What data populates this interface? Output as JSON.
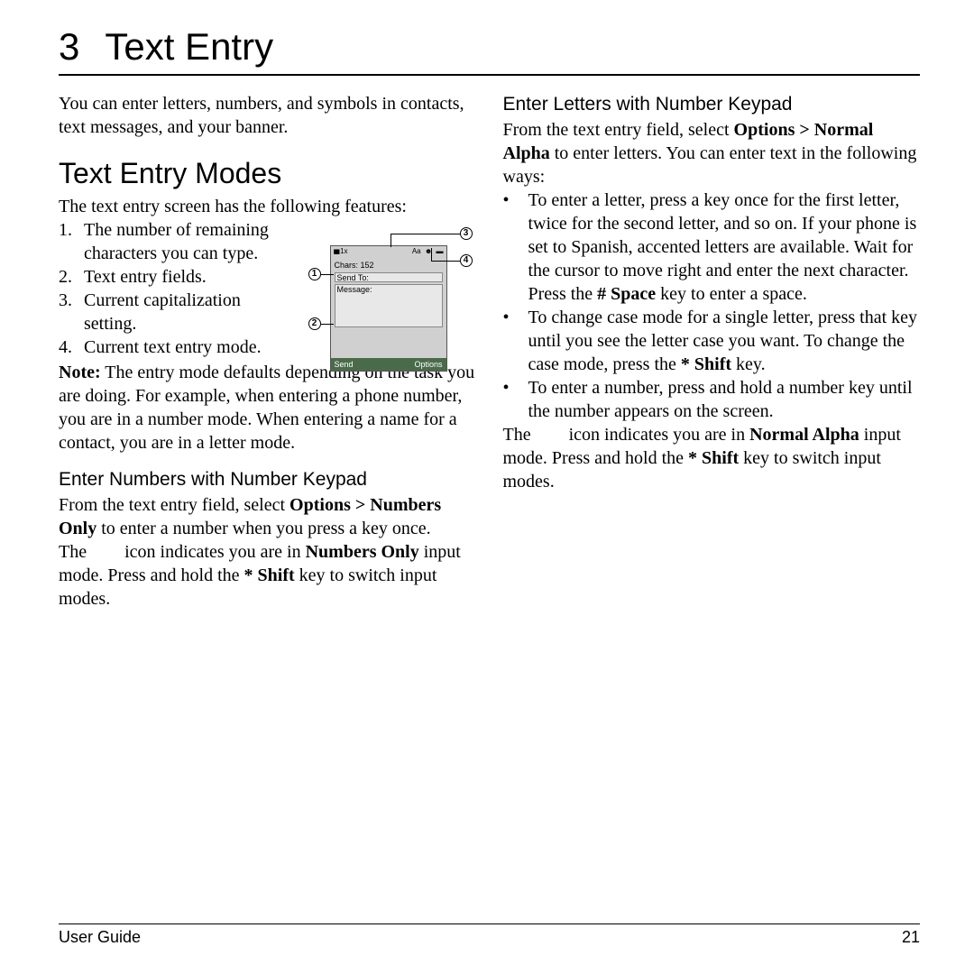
{
  "chapter": {
    "number": "3",
    "title": "Text Entry"
  },
  "intro": "You can enter letters, numbers, and symbols in contacts, text messages, and your banner.",
  "modes": {
    "heading": "Text Entry Modes",
    "lead": "The text entry screen has the following features:",
    "features": [
      "The number of remaining characters you can type.",
      "Text entry fields.",
      "Current capitalization setting.",
      "Current text entry mode."
    ],
    "note_label": "Note:",
    "note": " The entry mode defaults depending on the task you are doing. For example, when entering a phone number, you are in a number mode. When entering a name for a contact, you are in a letter mode."
  },
  "numbers_section": {
    "heading": "Enter Numbers with Number Keypad",
    "p1a": "From the text entry field, select ",
    "p1b": "Options > Numbers Only",
    "p1c": " to enter a number when you press a key once.",
    "p2a": "The ",
    "p2b": " icon indicates you are in ",
    "p2c": "Numbers Only",
    "p2d": " input mode. Press and hold the ",
    "p2e": "* Shift",
    "p2f": " key to switch input modes."
  },
  "letters_section": {
    "heading": "Enter Letters with Number Keypad",
    "p1a": "From the text entry field, select ",
    "p1b": "Options > Normal Alpha",
    "p1c": " to enter letters. You can enter text in the following ways:",
    "bullets": [
      {
        "a": "To enter a letter, press a key once for the first letter, twice for the second letter, and so on. If your phone is set to Spanish, accented letters are available. Wait for the cursor to move right and enter the next character. Press the ",
        "b": "# Space",
        "c": " key to enter a space."
      },
      {
        "a": "To change case mode for a single letter, press that key until you see the letter case you want. To change the case mode, press the ",
        "b": "* Shift",
        "c": " key."
      },
      {
        "a": "To enter a number, press and hold a number key until the number appears on the screen.",
        "b": "",
        "c": ""
      }
    ],
    "p2a": "The ",
    "p2b": " icon indicates you are in ",
    "p2c": "Normal Alpha",
    "p2d": " input mode. Press and hold the ",
    "p2e": "* Shift",
    "p2f": " key to switch input modes."
  },
  "diagram": {
    "chars": "Chars: 152",
    "send_to": "Send To:",
    "message": "Message:",
    "send": "Send",
    "options": "Options",
    "aa": "Aa",
    "callouts": [
      "1",
      "2",
      "3",
      "4"
    ]
  },
  "footer": {
    "left": "User Guide",
    "right": "21"
  }
}
